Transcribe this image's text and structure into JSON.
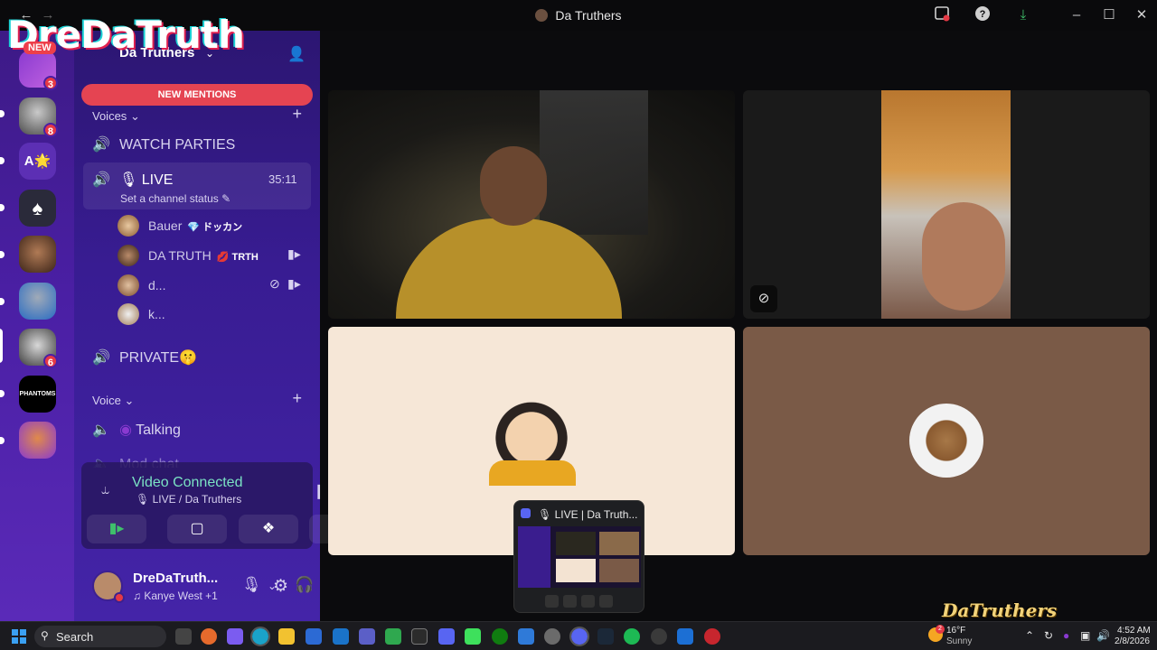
{
  "window": {
    "title": "Da Truthers",
    "back_icon": "arrow-left-icon",
    "forward_icon": "arrow-right-icon"
  },
  "watermark": {
    "text": "DreDaTruth",
    "badge": "NEW"
  },
  "servers": [
    {
      "badge": "3"
    },
    {
      "badge": "8"
    },
    {
      "label": "A🌟"
    },
    {
      "badge": ""
    },
    {
      "badge": ""
    },
    {
      "badge": ""
    },
    {
      "badge": "6"
    },
    {
      "label": "PHANTOMS"
    },
    {
      "badge": ""
    }
  ],
  "server_header": {
    "name": "Da Truthers"
  },
  "mentions_banner": "NEW MENTIONS",
  "categories": {
    "voices": "Voices",
    "voice": "Voice"
  },
  "channels": {
    "watch_parties": "WATCH PARTIES",
    "live": "LIVE",
    "live_timer": "35:11",
    "live_status": "Set a channel status",
    "private": "PRIVATE🤫",
    "talking": "Talking",
    "mod_chat": "Mod chat"
  },
  "members": [
    {
      "name": "Bauer",
      "tag": "💎 ドッカン"
    },
    {
      "name": "DA TRUTH",
      "tag": "💋 TRTH"
    },
    {
      "name": "d...",
      "tag": ""
    },
    {
      "name": "k...",
      "tag": ""
    }
  ],
  "voice_panel": {
    "title": "Video Connected",
    "subtitle": "LIVE / Da Truthers"
  },
  "user": {
    "name": "DreDaTruth...",
    "status": "Kanye West +1"
  },
  "popup": {
    "title": "LIVE | Da Truth..."
  },
  "overlay_logo": "DaTruthers",
  "taskbar": {
    "search_label": "Search",
    "weather_temp": "16°F",
    "weather_desc": "Sunny",
    "weather_badge": "2",
    "time": "4:52 AM",
    "date": "2/8/2026"
  },
  "colors": {
    "accent": "#7be3c4",
    "mention": "#e54452",
    "rail": "#4a1fa4"
  }
}
